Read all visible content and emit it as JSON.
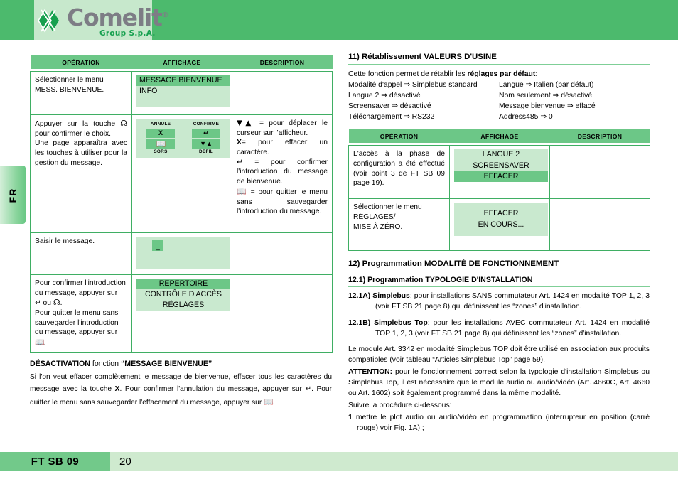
{
  "brand": {
    "name": "Comelit",
    "registered": "®",
    "subtitle": "Group S.p.A."
  },
  "side_tab": {
    "label": "FR"
  },
  "footer": {
    "doc_code": "FT SB 09",
    "page_number": "20"
  },
  "left_column": {
    "table": {
      "headers": [
        "OPÉRATION",
        "AFFICHAGE",
        "DESCRIPTION"
      ],
      "rows": [
        {
          "operation": "Sélectionner le menu\nMESS. BIENVENUE.",
          "operation_line1": "Sélectionner le menu",
          "operation_line2": "MESS. BIENVENUE.",
          "display": {
            "type": "lcd",
            "lines": [
              "MESSAGE BIENVENUE",
              "INFO"
            ],
            "selected_index": 0
          },
          "description": ""
        },
        {
          "operation_p1": "Appuyer sur la touche",
          "operation_p1_icon": "bell-icon",
          "operation_p1_end": "pour confirmer le choix.",
          "operation_p2": "Une page apparaîtra avec les touches à utiliser pour la gestion du message.",
          "display": {
            "type": "keypad",
            "caption_top_left": "ANNULE",
            "caption_top_right": "CONFIRME",
            "caption_bottom_left": "SORS",
            "caption_bottom_right": "DEFIL",
            "key_top_left": "X",
            "key_top_right": "enter-arrow-icon",
            "key_bottom_left": "book-icon",
            "key_bottom_right": "down-up-arrows-icon"
          },
          "description_items": [
            {
              "icon": "down-up-arrows-icon",
              "text": "= pour déplacer le curseur sur l'afficheur."
            },
            {
              "icon": "x-key",
              "text": "= pour effacer un caractère."
            },
            {
              "icon": "enter-arrow-icon",
              "text": "= pour confirmer l'introduction du message de bienvenue."
            },
            {
              "icon": "book-icon",
              "text": "= pour quitter le menu sans sauvegarder l'introduction du message."
            }
          ]
        },
        {
          "operation_line1": "Saisir le message.",
          "display": {
            "type": "lcd-cursor",
            "cursor": "_"
          },
          "description": ""
        },
        {
          "operation_p1": "Pour confirmer l'introduction du message, appuyer sur",
          "operation_p1_mid": "ou",
          "operation_p1_end": ".",
          "operation_p2": "Pour quitter le menu sans sauvegarder l'introduction du message, appuyer sur",
          "operation_p2_end": ".",
          "display": {
            "type": "lcd",
            "lines": [
              "REPERTOIRE",
              "CONTRÔLE D'ACCÈS",
              "RÉGLAGES"
            ],
            "selected_index": 0,
            "centered": true
          },
          "description": ""
        }
      ]
    },
    "deactivation": {
      "heading_prefix": "DÉSACTIVATION",
      "heading_mid": "fonction",
      "heading_quoted": "“MESSAGE BIENVENUE”",
      "paragraph_1": "Si l'on veut effacer complètement le message de bienvenue, effacer tous les caractères du message avec la touche",
      "key_x": "X",
      "paragraph_2": ". Pour confirmer l'annulation du message, appuyer sur",
      "paragraph_3": ". Pour quitter le menu sans sauvegarder l'effacement du message, appuyer sur",
      "paragraph_4": "."
    }
  },
  "right_column": {
    "section_11": {
      "title": "11) Rétablissement VALEURS D'USINE",
      "intro_plain": "Cette fonction permet de rétablir les ",
      "intro_bold": "réglages par défaut:",
      "defaults_left": [
        "Modalité d'appel ⇒ Simplebus standard",
        "Langue 2 ⇒ désactivé",
        "Screensaver ⇒ désactivé",
        "Téléchargement ⇒ RS232"
      ],
      "defaults_right": [
        "Langue ⇒ Italien (par défaut)",
        "Nom seulement ⇒ désactivé",
        "Message bienvenue ⇒ effacé",
        "Address485 ⇒ 0"
      ]
    },
    "table": {
      "headers": [
        "OPÉRATION",
        "AFFICHAGE",
        "DESCRIPTION"
      ],
      "rows": [
        {
          "operation": "L'accès à la phase de configuration a été effectué (voir point 3 de FT SB 09 page 19).",
          "display": {
            "type": "lcd",
            "lines": [
              "LANGUE 2",
              "SCREENSAVER",
              "EFFACER"
            ],
            "selected_index": 2,
            "centered": true
          },
          "description": ""
        },
        {
          "operation_line1": "Sélectionner le menu",
          "operation_line2": "RÉGLAGES/",
          "operation_line3": "MISE À ZÉRO.",
          "display": {
            "type": "lcd",
            "lines": [
              "EFFACER",
              "EN COURS..."
            ],
            "selected_index": -1,
            "centered": true
          },
          "description": ""
        }
      ]
    },
    "section_12": {
      "title": "12) Programmation MODALITÉ DE FONCTIONNEMENT",
      "subtitle": "12.1) Programmation TYPOLOGIE D'INSTALLATION",
      "item_a_label": "12.1A)",
      "item_a_bold": "Simplebus",
      "item_a_text": ": pour installations SANS commutateur Art. 1424 en modalité TOP 1, 2, 3 (voir FT SB 21 page 8) qui définissent les “zones” d'installation.",
      "item_b_label": "12.1B)",
      "item_b_bold": "Simplebus Top",
      "item_b_text": ": pour les installations AVEC commutateur Art. 1424 en modalité TOP 1, 2, 3 (voir FT SB 21 page 8) qui définissent les “zones” d'installation.",
      "paragraph_module": "Le module Art. 3342 en modalité Simplebus TOP doit être utilisé en association aux produits compatibles (voir tableau “Articles Simplebus Top” page 59).",
      "attention_label": "ATTENTION:",
      "attention_text": " pour le fonctionnement correct selon la typologie d'installation Simplebus ou Simplebus Top, il est nécessaire que le module audio ou audio/vidéo (Art. 4660C, Art. 4660 ou Art. 1602) soit également programmé dans la même modalité.",
      "procedure_intro": "Suivre la procédure ci-dessous:",
      "step_1_num": "1",
      "step_1_text": "mettre le plot audio ou audio/vidéo en programmation (interrupteur en position (carré rouge) voir Fig. 1A) ;"
    }
  },
  "colors": {
    "brand_green": "#4cba6d",
    "header_row": "#6cc787",
    "lcd_bg": "#c9e9cf",
    "lcd_selected": "#6cc787",
    "border": "#3fae63",
    "rule": "#7fcf97",
    "footer_tint": "#cfeacf",
    "logo_gray": "#7d7d85",
    "logo_green": "#16a04f"
  }
}
